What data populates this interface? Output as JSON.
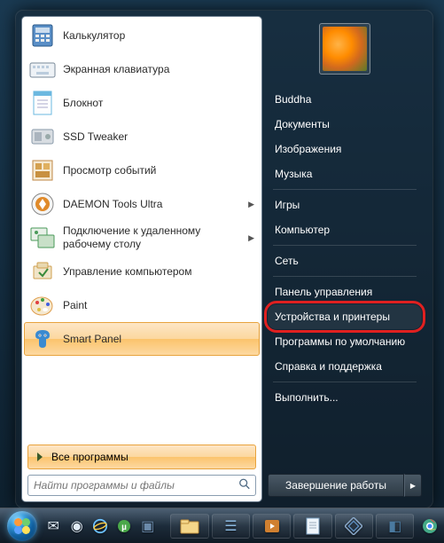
{
  "left_panel": {
    "programs": [
      {
        "name": "Калькулятор",
        "icon": "calculator",
        "has_menu": false
      },
      {
        "name": "Экранная клавиатура",
        "icon": "keyboard",
        "has_menu": false
      },
      {
        "name": "Блокнот",
        "icon": "notepad",
        "has_menu": false
      },
      {
        "name": "SSD Tweaker",
        "icon": "ssd",
        "has_menu": false
      },
      {
        "name": "Просмотр событий",
        "icon": "eventviewer",
        "has_menu": false
      },
      {
        "name": "DAEMON Tools Ultra",
        "icon": "daemon",
        "has_menu": true
      },
      {
        "name": "Подключение к удаленному рабочему столу",
        "icon": "rdp",
        "has_menu": true
      },
      {
        "name": "Управление компьютером",
        "icon": "mgmt",
        "has_menu": false
      },
      {
        "name": "Paint",
        "icon": "paint",
        "has_menu": false
      },
      {
        "name": "Smart Panel",
        "icon": "smartpanel",
        "has_menu": false,
        "highlighted": true
      }
    ],
    "all_programs_label": "Все программы",
    "search_placeholder": "Найти программы и файлы"
  },
  "right_panel": {
    "username": "Buddha",
    "items": [
      {
        "label": "Документы"
      },
      {
        "label": "Изображения"
      },
      {
        "label": "Музыка"
      },
      {
        "sep": true
      },
      {
        "label": "Игры"
      },
      {
        "label": "Компьютер"
      },
      {
        "sep": true
      },
      {
        "label": "Сеть"
      },
      {
        "sep": true
      },
      {
        "label": "Панель управления"
      },
      {
        "label": "Устройства и принтеры",
        "highlighted": true
      },
      {
        "label": "Программы по умолчанию"
      },
      {
        "label": "Справка и поддержка"
      },
      {
        "sep": true
      },
      {
        "label": "Выполнить..."
      }
    ],
    "shutdown_label": "Завершение работы"
  },
  "icon_colors": {
    "calculator": "#5a8fc7",
    "keyboard": "#7a8a9a",
    "notepad": "#6bb8e0",
    "ssd": "#8a9aaa",
    "eventviewer": "#c08a4a",
    "daemon": "#e08a2a",
    "rdp": "#4a9a5a",
    "mgmt": "#d0a050",
    "paint": "#e0a050",
    "smartpanel": "#3a8ad0"
  }
}
